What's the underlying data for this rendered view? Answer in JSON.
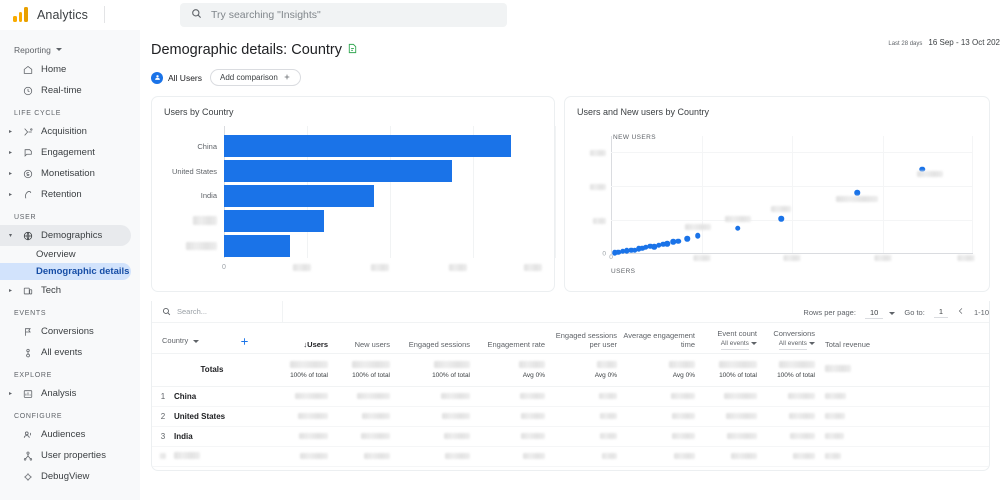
{
  "header": {
    "brand": "Analytics",
    "logo_icon": "google-analytics-logo",
    "search_icon": "search-icon",
    "search_placeholder": "Try searching \"Insights\"",
    "search_value": ""
  },
  "sidebar": {
    "reporting_label": "Reporting",
    "reporting_caret_icon": "chevron-down-icon",
    "items": [
      {
        "label": "Home",
        "icon": "home-icon",
        "expandable": false
      },
      {
        "label": "Real-time",
        "icon": "clock-icon",
        "expandable": false
      }
    ],
    "groups": [
      {
        "title": "LIFE CYCLE",
        "items": [
          {
            "label": "Acquisition",
            "icon": "acquisition-icon",
            "expandable": true
          },
          {
            "label": "Engagement",
            "icon": "engagement-icon",
            "expandable": true
          },
          {
            "label": "Monetisation",
            "icon": "monetisation-icon",
            "expandable": true
          },
          {
            "label": "Retention",
            "icon": "retention-icon",
            "expandable": true
          }
        ]
      },
      {
        "title": "USER",
        "items": [
          {
            "label": "Demographics",
            "icon": "globe-icon",
            "expandable": true,
            "active": true
          },
          {
            "label": "Tech",
            "icon": "devices-icon",
            "expandable": true
          }
        ],
        "subitems": [
          {
            "label": "Overview",
            "selected": false
          },
          {
            "label": "Demographic details",
            "selected": true
          }
        ]
      },
      {
        "title": "EVENTS",
        "items": [
          {
            "label": "Conversions",
            "icon": "flag-icon",
            "expandable": false
          },
          {
            "label": "All events",
            "icon": "events-icon",
            "expandable": false
          }
        ]
      },
      {
        "title": "EXPLORE",
        "items": [
          {
            "label": "Analysis",
            "icon": "analysis-icon",
            "expandable": true
          }
        ]
      },
      {
        "title": "CONFIGURE",
        "items": [
          {
            "label": "Audiences",
            "icon": "audiences-icon",
            "expandable": false
          },
          {
            "label": "User properties",
            "icon": "user-properties-icon",
            "expandable": false
          },
          {
            "label": "DebugView",
            "icon": "debug-icon",
            "expandable": false
          }
        ]
      }
    ]
  },
  "page": {
    "title": "Demographic details: Country",
    "title_badge_icon": "insights-doc-icon",
    "segment_chip": "All Users",
    "segment_chip_icon": "audience-icon",
    "add_comparison": "Add comparison",
    "add_comparison_icon": "plus-icon",
    "date_label": "Last 28 days",
    "date_range": "16 Sep - 13 Oct 202"
  },
  "chart_data": [
    {
      "type": "bar",
      "title": "Users by Country",
      "orientation": "horizontal",
      "xlabel": "",
      "ylabel": "",
      "categories": [
        "China",
        "United States",
        "India",
        "[redacted]",
        "[redacted]"
      ],
      "categories_redacted": [
        false,
        false,
        false,
        true,
        true
      ],
      "values": [
        92,
        73,
        48,
        32,
        21
      ],
      "value_unit": "percent-of-axis",
      "xticks": [
        "0",
        "[redacted]",
        "[redacted]",
        "[redacted]",
        "[redacted]"
      ],
      "xticks_redacted": [
        false,
        true,
        true,
        true,
        true
      ],
      "grid": true,
      "color": "#1a73e8"
    },
    {
      "type": "scatter",
      "title": "Users and New users by Country",
      "xlabel": "USERS",
      "ylabel": "NEW USERS",
      "xticks": [
        "0",
        "[redacted]",
        "[redacted]",
        "[redacted]",
        "[redacted]"
      ],
      "xticks_redacted": [
        false,
        true,
        true,
        true,
        true
      ],
      "yticks": [
        "0",
        "[redacted]",
        "[redacted]",
        "[redacted]"
      ],
      "yticks_redacted": [
        false,
        true,
        true,
        true
      ],
      "grid": true,
      "color": "#1a73e8",
      "points": [
        {
          "x": 1.0,
          "y": 1.0,
          "label": ""
        },
        {
          "x": 2.0,
          "y": 1.5,
          "label": ""
        },
        {
          "x": 3.2,
          "y": 2.2,
          "label": ""
        },
        {
          "x": 4.4,
          "y": 2.8,
          "label": ""
        },
        {
          "x": 5.6,
          "y": 3.4,
          "label": ""
        },
        {
          "x": 6.6,
          "y": 3.0,
          "label": ""
        },
        {
          "x": 7.6,
          "y": 4.4,
          "label": ""
        },
        {
          "x": 8.6,
          "y": 5.0,
          "label": ""
        },
        {
          "x": 9.6,
          "y": 5.6,
          "label": ""
        },
        {
          "x": 10.8,
          "y": 6.4,
          "label": ""
        },
        {
          "x": 12.0,
          "y": 6.0,
          "label": ""
        },
        {
          "x": 13.2,
          "y": 7.4,
          "label": ""
        },
        {
          "x": 14.4,
          "y": 8.2,
          "label": ""
        },
        {
          "x": 15.6,
          "y": 8.8,
          "label": ""
        },
        {
          "x": 17.2,
          "y": 10.4,
          "label": ""
        },
        {
          "x": 18.6,
          "y": 11.0,
          "label": ""
        },
        {
          "x": 21.0,
          "y": 13.0,
          "label": ""
        },
        {
          "x": 24.0,
          "y": 15.6,
          "label": "[redacted]"
        },
        {
          "x": 35.0,
          "y": 22.0,
          "label": "[redacted]"
        },
        {
          "x": 47.0,
          "y": 30.0,
          "label": "[redacted]"
        },
        {
          "x": 68.0,
          "y": 52.0,
          "label": "[redacted]"
        },
        {
          "x": 86.0,
          "y": 72.0,
          "label": "[redacted]"
        }
      ]
    }
  ],
  "table": {
    "search_icon": "search-icon",
    "search_placeholder": "Search...",
    "dimension_header": "Country",
    "dimension_caret_icon": "chevron-down-icon",
    "add_dimension_icon": "plus-icon",
    "rows_per_page_label": "Rows per page:",
    "rows_per_page_value": "10",
    "rows_per_page_caret_icon": "chevron-down-icon",
    "goto_label": "Go to:",
    "goto_value": "1",
    "prev_page_icon": "chevron-left-icon",
    "range_label": "1-10",
    "columns": [
      {
        "label": "Users",
        "sorted": true,
        "sort_icon": "arrow-down-icon",
        "sub": ""
      },
      {
        "label": "New users",
        "sorted": false,
        "sub": ""
      },
      {
        "label": "Engaged sessions",
        "sorted": false,
        "sub": ""
      },
      {
        "label": "Engagement rate",
        "sorted": false,
        "sub": ""
      },
      {
        "label": "Engaged sessions per user",
        "sorted": false,
        "sub": ""
      },
      {
        "label": "Average engagement time",
        "sorted": false,
        "sub": ""
      },
      {
        "label": "Event count",
        "sorted": false,
        "sub": "All events"
      },
      {
        "label": "Conversions",
        "sorted": false,
        "sub": "All events"
      },
      {
        "label": "Total revenue",
        "sorted": false,
        "sub": ""
      }
    ],
    "totals_label": "Totals",
    "totals": [
      {
        "value": "[redacted]",
        "sub": "100% of total"
      },
      {
        "value": "[redacted]",
        "sub": "100% of total"
      },
      {
        "value": "[redacted]",
        "sub": "100% of total"
      },
      {
        "value": "[redacted]",
        "sub": "Avg 0%"
      },
      {
        "value": "[redacted]",
        "sub": "Avg 0%"
      },
      {
        "value": "[redacted]",
        "sub": "Avg 0%"
      },
      {
        "value": "[redacted]",
        "sub": "100% of total"
      },
      {
        "value": "[redacted]",
        "sub": "100% of total"
      },
      {
        "value": "[redacted]",
        "sub": ""
      }
    ],
    "rows": [
      {
        "index": "1",
        "name": "China",
        "redacted": false
      },
      {
        "index": "2",
        "name": "United States",
        "redacted": false
      },
      {
        "index": "3",
        "name": "India",
        "redacted": false
      },
      {
        "index": "[redacted]",
        "name": "[redacted]",
        "redacted": true
      },
      {
        "index": "[redacted]",
        "name": "[redacted]",
        "redacted": true
      }
    ]
  }
}
